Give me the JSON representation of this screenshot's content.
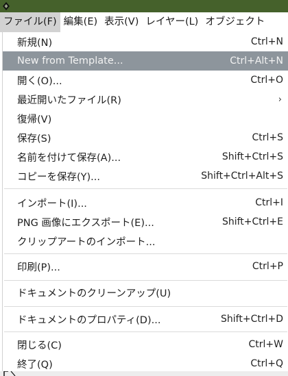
{
  "window": {
    "titlebar_color": "#45612b"
  },
  "menubar": {
    "items": [
      {
        "label": "ファイル(F)",
        "active": true
      },
      {
        "label": "編集(E)"
      },
      {
        "label": "表示(V)"
      },
      {
        "label": "レイヤー(L)"
      },
      {
        "label": "オブジェクト"
      }
    ]
  },
  "file_menu": {
    "highlight_color": "#8d959c",
    "items": [
      {
        "label": "新規(N)",
        "shortcut": "Ctrl+N"
      },
      {
        "label": "New from Template...",
        "shortcut": "Ctrl+Alt+N"
      },
      {
        "label": "開く(O)...",
        "shortcut": "Ctrl+O"
      },
      {
        "label": "最近開いたファイル(R)",
        "submenu_icon": "chevron-right-icon"
      },
      {
        "label": "復帰(V)"
      },
      {
        "label": "保存(S)",
        "shortcut": "Ctrl+S"
      },
      {
        "label": "名前を付けて保存(A)...",
        "shortcut": "Shift+Ctrl+S"
      },
      {
        "label": "コピーを保存(Y)...",
        "shortcut": "Shift+Ctrl+Alt+S"
      },
      {
        "label": "インポート(I)...",
        "shortcut": "Ctrl+I"
      },
      {
        "label": "PNG 画像にエクスポート(E)...",
        "shortcut": "Shift+Ctrl+E"
      },
      {
        "label": "クリップアートのインポート..."
      },
      {
        "label": "印刷(P)...",
        "shortcut": "Ctrl+P"
      },
      {
        "label": "ドキュメントのクリーンアップ(U)"
      },
      {
        "label": "ドキュメントのプロパティ(D)...",
        "shortcut": "Shift+Ctrl+D"
      },
      {
        "label": "閉じる(C)",
        "shortcut": "Ctrl+W"
      },
      {
        "label": "終了(Q)",
        "shortcut": "Ctrl+Q"
      }
    ]
  }
}
